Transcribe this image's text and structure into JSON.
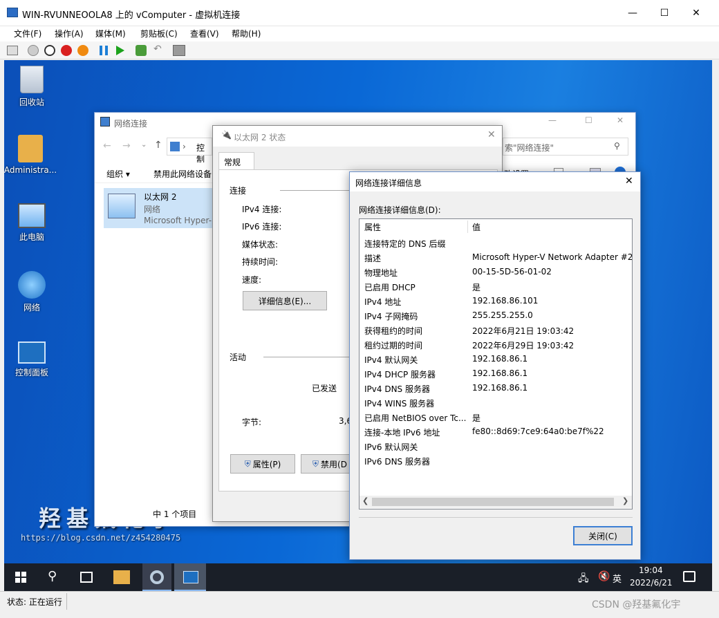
{
  "vm": {
    "title": "WIN-RVUNNEOOLA8 上的 vComputer - 虚拟机连接",
    "menu": [
      "文件(F)",
      "操作(A)",
      "媒体(M)",
      "剪贴板(C)",
      "查看(V)",
      "帮助(H)"
    ],
    "status_label": "状态: 正在运行"
  },
  "desktop": {
    "icons": [
      "回收站",
      "Administra...",
      "此电脑",
      "网络",
      "控制面板"
    ],
    "watermark_title": "羟基氟化宇",
    "watermark_url": "https://blog.csdn.net/z454280475"
  },
  "explorer": {
    "title": "网络连接",
    "address": "控制",
    "search_placeholder": "索\"网络连接\"",
    "organize": "组织 ▾",
    "disable_device": "禁用此网络设备",
    "settings_frag": "改设置",
    "adapter_name": "以太网 2",
    "adapter_type": "网络",
    "adapter_desc": "Microsoft Hyper-",
    "item_count": "中 1 个项目"
  },
  "status": {
    "title": "以太网 2 状态",
    "tab": "常规",
    "group_connect": "连接",
    "fields": [
      "IPv4 连接:",
      "IPv6 连接:",
      "媒体状态:",
      "持续时间:",
      "速度:"
    ],
    "details_button": "详细信息(E)...",
    "group_activity": "活动",
    "sent": "已发送",
    "bytes": "字节:",
    "bytes_val": "3,6",
    "properties_button": "属性(P)",
    "disable_button": "禁用(D"
  },
  "details": {
    "title": "网络连接详细信息",
    "label": "网络连接详细信息(D):",
    "col_prop": "属性",
    "col_val": "值",
    "rows": [
      {
        "p": "连接特定的 DNS 后缀",
        "v": ""
      },
      {
        "p": "描述",
        "v": "Microsoft Hyper-V Network Adapter #2"
      },
      {
        "p": "物理地址",
        "v": "00-15-5D-56-01-02"
      },
      {
        "p": "已启用 DHCP",
        "v": "是"
      },
      {
        "p": "IPv4 地址",
        "v": "192.168.86.101"
      },
      {
        "p": "IPv4 子网掩码",
        "v": "255.255.255.0"
      },
      {
        "p": "获得租约的时间",
        "v": "2022年6月21日 19:03:42"
      },
      {
        "p": "租约过期的时间",
        "v": "2022年6月29日 19:03:42"
      },
      {
        "p": "IPv4 默认网关",
        "v": "192.168.86.1"
      },
      {
        "p": "IPv4 DHCP 服务器",
        "v": "192.168.86.1"
      },
      {
        "p": "IPv4 DNS 服务器",
        "v": "192.168.86.1"
      },
      {
        "p": "IPv4 WINS 服务器",
        "v": ""
      },
      {
        "p": "已启用 NetBIOS over Tc...",
        "v": "是"
      },
      {
        "p": "连接-本地 IPv6 地址",
        "v": "fe80::8d69:7ce9:64a0:be7f%22"
      },
      {
        "p": "IPv6 默认网关",
        "v": ""
      },
      {
        "p": "IPv6 DNS 服务器",
        "v": ""
      }
    ],
    "close_button": "关闭(C)"
  },
  "taskbar": {
    "lang": "英",
    "time": "19:04",
    "date": "2022/6/21"
  },
  "csdn_mark": "CSDN @羟基氟化宇"
}
